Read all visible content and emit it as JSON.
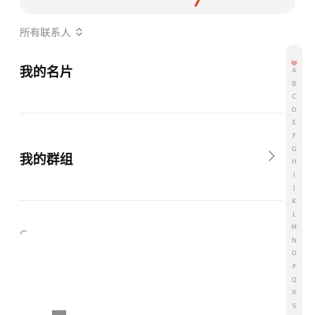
{
  "filter": {
    "label": "所有联系人"
  },
  "rows": [
    {
      "label": "我的名片"
    },
    {
      "label": "我的群组"
    }
  ],
  "index": {
    "letters": [
      "A",
      "B",
      "C",
      "D",
      "E",
      "F",
      "G",
      "H",
      "I",
      "J",
      "K",
      "L",
      "M",
      "N",
      "O",
      "P",
      "Q",
      "R",
      "S"
    ]
  },
  "colors": {
    "accent": "#e0453a",
    "heart": "#e8a1a3",
    "muted_text": "#8a8a8a",
    "primary_text": "#111111"
  },
  "icons": {
    "filter_toggle": "chevron-up-down-icon",
    "row_arrow": "chevron-right-icon",
    "index_favorite": "heart-icon",
    "loading": "spinner-icon"
  }
}
